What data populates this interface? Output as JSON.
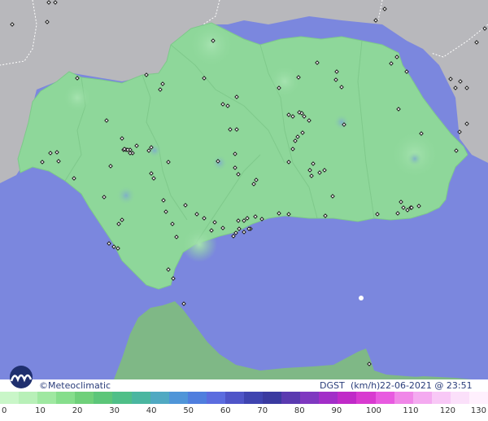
{
  "credit": "©Meteoclimatic",
  "variable": "DGST",
  "units": "(km/h)",
  "datetime": "22-06-2021 @ 23:51 UTC",
  "icons": {
    "logo": "meteoclimatic-logo-icon"
  },
  "colors": {
    "sea": "#7b87de",
    "land_outside": "#b8b8bc",
    "andalusia": "#8ed79a",
    "morocco": "#7fb886",
    "footer_text": "#2a3d7a"
  },
  "scale_ticks": [
    "0",
    "10",
    "20",
    "30",
    "40",
    "50",
    "60",
    "70",
    "80",
    "90",
    "100",
    "110",
    "120",
    "130"
  ],
  "scale_colors": [
    "#c9f6c8",
    "#b8f0b8",
    "#9fe8a1",
    "#86de8c",
    "#6fd07a",
    "#5cc679",
    "#4fbf88",
    "#4ab6a0",
    "#50a9c2",
    "#4f95d8",
    "#4f7ede",
    "#5b6cdf",
    "#4f55c8",
    "#3f44b0",
    "#3a3aa0",
    "#5a3ab0",
    "#7f38c0",
    "#a22ec8",
    "#c02ac8",
    "#d83ad0",
    "#e85ae0",
    "#f087e8",
    "#f4aaf0",
    "#f8c8f6",
    "#fbe0fa",
    "#fff0fd"
  ]
}
